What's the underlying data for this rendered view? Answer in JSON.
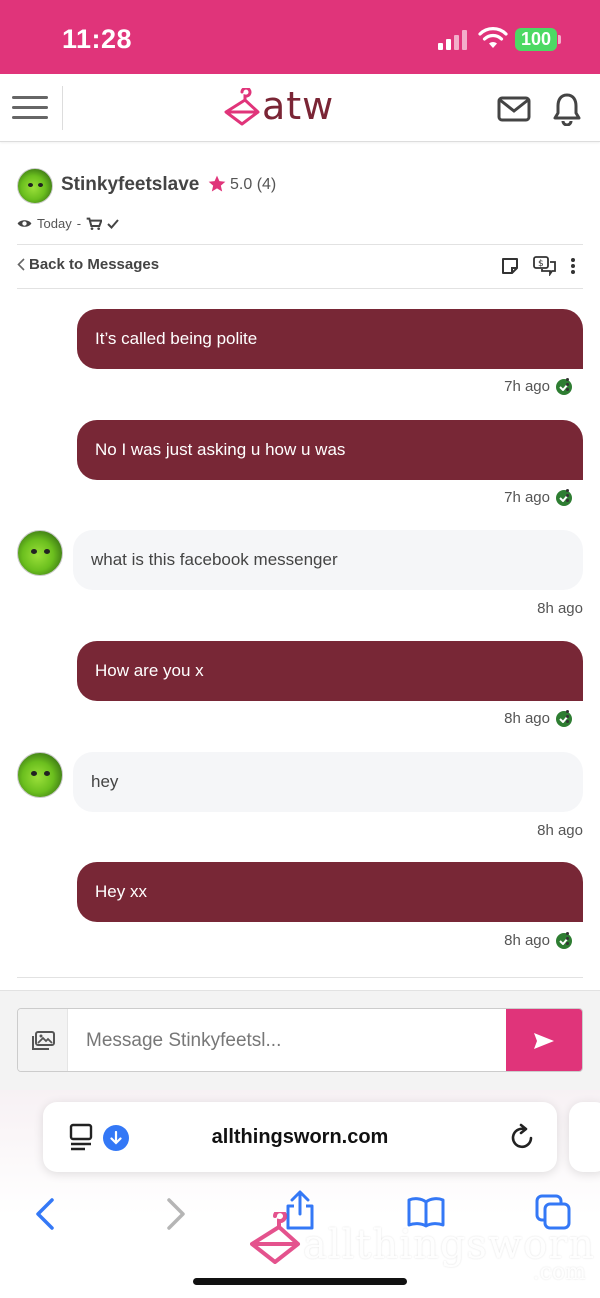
{
  "status_bar": {
    "time": "11:28",
    "battery": "100",
    "accent": "#e0347a"
  },
  "app": {
    "logo_text": "atw",
    "brand_color": "#782736"
  },
  "conversation": {
    "seller_name": "Stinkyfeetslave",
    "rating": "5.0",
    "rating_count": "(4)",
    "last_seen": "Today",
    "meta_separator": "-",
    "back_label": "Back to Messages"
  },
  "messages": [
    {
      "direction": "out",
      "text": "It’s called being polite",
      "time": "7h ago"
    },
    {
      "direction": "out",
      "text": "No I was just asking u how u was",
      "time": "7h ago"
    },
    {
      "direction": "in",
      "text": "what is this facebook messenger",
      "time": "8h ago"
    },
    {
      "direction": "out",
      "text": "How are you x",
      "time": "8h ago"
    },
    {
      "direction": "in",
      "text": "hey",
      "time": "8h ago"
    },
    {
      "direction": "out",
      "text": "Hey xx",
      "time": "8h ago"
    }
  ],
  "composer": {
    "placeholder": "Message Stinkyfeetsl..."
  },
  "browser": {
    "url": "allthingsworn.com",
    "watermark_text": "allthingsworn",
    "watermark_suffix": ".com"
  }
}
